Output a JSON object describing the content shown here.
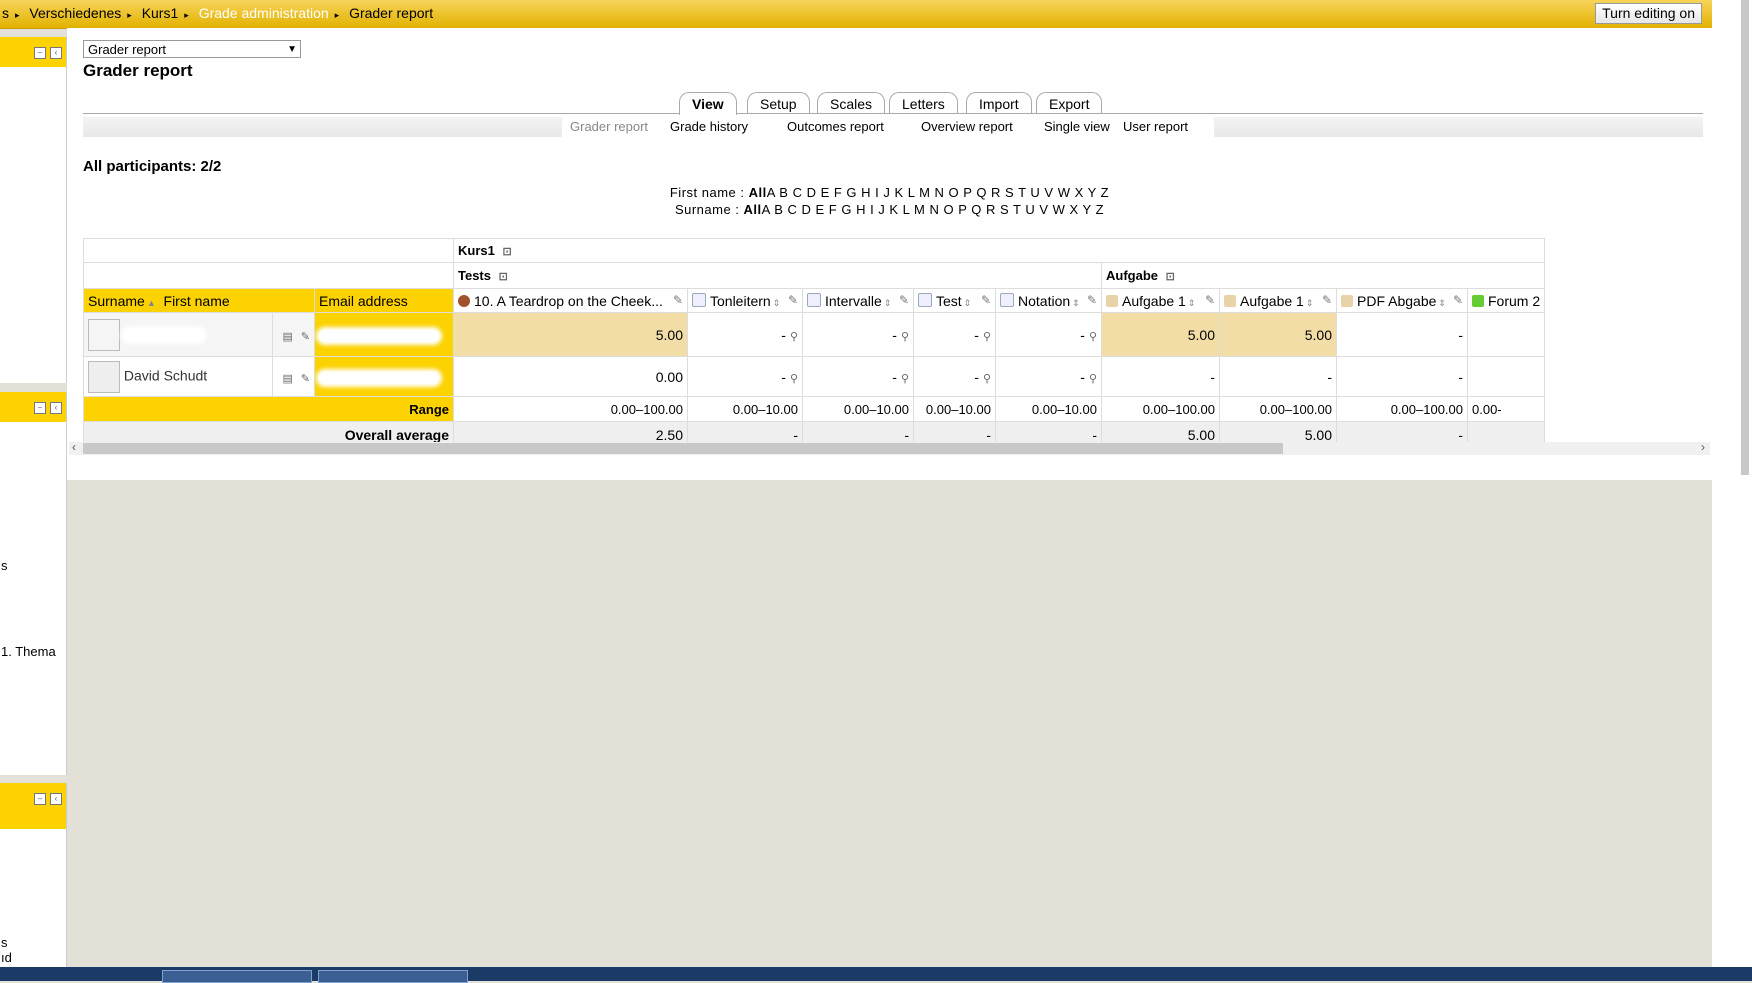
{
  "breadcrumb": [
    "s",
    "Verschiedenes",
    "Kurs1",
    "Grade administration",
    "Grader report"
  ],
  "turn_editing_label": "Turn editing on",
  "sidebar": {
    "text1": "s",
    "text2": "1. Thema",
    "text3": "s",
    "text4": "ıd"
  },
  "selector": {
    "value": "Grader report"
  },
  "page_title": "Grader report",
  "tabs": [
    "View",
    "Setup",
    "Scales",
    "Letters",
    "Import",
    "Export"
  ],
  "subtabs": [
    "Grader report",
    "Grade history",
    "Outcomes report",
    "Overview report",
    "Single view",
    "User report"
  ],
  "participants": "All participants: 2/2",
  "initials": {
    "first_label": "First name : ",
    "surname_label": "Surname : ",
    "all": "All",
    "letters": "A B C D E F G H I J K L M N O P Q R S T U V W X Y Z"
  },
  "table": {
    "category_course": "Kurs1",
    "category_tests": "Tests",
    "category_aufgabe": "Aufgabe",
    "header_surname": "Surname",
    "header_firstname": "First name",
    "header_email": "Email address",
    "columns": [
      "10. A Teardrop on the Cheek...",
      "Tonleitern",
      "Intervalle",
      "Test",
      "Notation",
      "Aufgabe 1",
      "Aufgabe 1",
      "PDF Abgabe",
      "Forum 2"
    ],
    "rows": [
      {
        "name": "",
        "grades": [
          "5.00",
          "-",
          "-",
          "-",
          "-",
          "5.00",
          "5.00",
          "-",
          ""
        ]
      },
      {
        "name": "David Schudt",
        "grades": [
          "0.00",
          "-",
          "-",
          "-",
          "-",
          "-",
          "-",
          "-",
          ""
        ]
      }
    ],
    "range_label": "Range",
    "ranges": [
      "0.00–100.00",
      "0.00–10.00",
      "0.00–10.00",
      "0.00–10.00",
      "0.00–10.00",
      "0.00–100.00",
      "0.00–100.00",
      "0.00–100.00",
      "0.00-"
    ],
    "avg_label": "Overall average",
    "averages": [
      "2.50",
      "-",
      "-",
      "-",
      "-",
      "5.00",
      "5.00",
      "-",
      ""
    ]
  },
  "colors": {
    "accent": "#fcd200",
    "highlight": "#f2dda6"
  }
}
